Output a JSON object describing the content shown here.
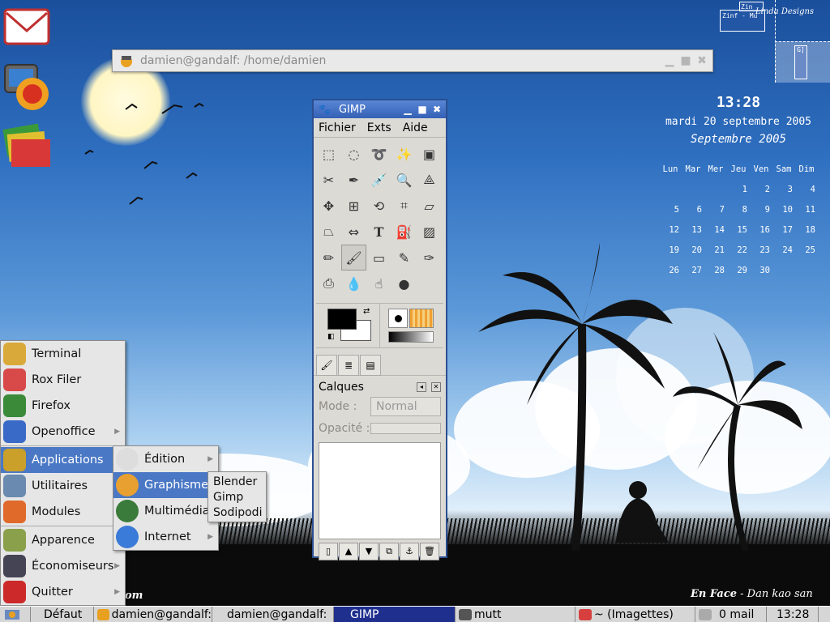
{
  "terminal_window": {
    "title": "damien@gandalf: /home/damien"
  },
  "gimp": {
    "title": "GIMP",
    "menu": [
      "Fichier",
      "Exts",
      "Aide"
    ],
    "tool_icons": [
      "rect-select-icon",
      "ellipse-select-icon",
      "lasso-icon",
      "fuzzy-select-icon",
      "color-select-icon",
      "scissors-icon",
      "paths-icon",
      "color-picker-icon",
      "zoom-icon",
      "measure-icon",
      "move-icon",
      "align-icon",
      "transform-icon",
      "crop-icon",
      "perspective-icon",
      "shear-icon",
      "flip-icon",
      "text-icon",
      "bucket-fill-icon",
      "blend-icon",
      "pencil-icon",
      "paintbrush-icon",
      "eraser-icon",
      "airbrush-icon",
      "ink-icon",
      "clone-icon",
      "blur-icon",
      "smudge-icon",
      "dodge-icon"
    ],
    "active_tool": "paintbrush-icon",
    "layers": {
      "title": "Calques",
      "mode_label": "Mode :",
      "mode_value": "Normal",
      "opacity_label": "Opacité :"
    },
    "layer_buttons": [
      "new-layer-icon",
      "raise-layer-icon",
      "lower-layer-icon",
      "duplicate-layer-icon",
      "anchor-layer-icon",
      "delete-layer-icon"
    ]
  },
  "clock": {
    "time": "13:28",
    "date": "mardi 20 septembre 2005",
    "month": "Septembre 2005"
  },
  "calendar": {
    "days": [
      "Lun",
      "Mar",
      "Mer",
      "Jeu",
      "Ven",
      "Sam",
      "Dim"
    ],
    "weeks": [
      [
        "",
        "",
        "",
        "1",
        "2",
        "3",
        "4"
      ],
      [
        "5",
        "6",
        "7",
        "8",
        "9",
        "10",
        "11"
      ],
      [
        "12",
        "13",
        "14",
        "15",
        "16",
        "17",
        "18"
      ],
      [
        "19",
        "20",
        "21",
        "22",
        "23",
        "24",
        "25"
      ],
      [
        "26",
        "27",
        "28",
        "29",
        "30",
        "",
        ""
      ]
    ]
  },
  "pager": {
    "label1": "Zinf - Mu",
    "label2": "Zin",
    "label3": "G]",
    "brand": "Linda Designs"
  },
  "main_menu": [
    {
      "label": "Terminal",
      "icon": "terminal-shell-icon",
      "color": "#d9a93a"
    },
    {
      "label": "Rox Filer",
      "icon": "rox-filer-icon",
      "color": "#d84a4a"
    },
    {
      "label": "Firefox",
      "icon": "firefox-icon",
      "color": "#3a8a3a"
    },
    {
      "label": "Openoffice",
      "icon": "openoffice-icon",
      "color": "#3a6ac8"
    },
    {
      "label": "Applications",
      "icon": "applications-gear-icon",
      "color": "#caa02a"
    },
    {
      "label": "Utilitaires",
      "icon": "utilities-icon",
      "color": "#6a8ab0"
    },
    {
      "label": "Modules",
      "icon": "modules-cube-icon",
      "color": "#e06a2a"
    },
    {
      "label": "Apparence",
      "icon": "appearance-icon",
      "color": "#8aa04a"
    },
    {
      "label": "Économiseurs",
      "icon": "screensaver-icon",
      "color": "#445"
    },
    {
      "label": "Quitter",
      "icon": "quit-icon",
      "color": "#cc2a2a"
    }
  ],
  "apps_submenu": [
    {
      "label": "Édition",
      "icon": "quill-icon",
      "color": "#ddd"
    },
    {
      "label": "Graphisme",
      "icon": "palette-icon",
      "color": "#e8a030"
    },
    {
      "label": "Multimédia",
      "icon": "multimedia-icon",
      "color": "#3a7a3a"
    },
    {
      "label": "Internet",
      "icon": "globe-icon",
      "color": "#3a7ad8"
    }
  ],
  "graphics_submenu": [
    "Blender",
    "Gimp",
    "Sodipodi"
  ],
  "wallpaper_caption": {
    "title": "En Face",
    "author": " - Dan kao san",
    "left_fragment": "om"
  },
  "taskbar": {
    "start_icon": "start-menu-icon",
    "items": [
      {
        "label": "Défaut",
        "icon": "",
        "active": false
      },
      {
        "label": "damien@gandalf:",
        "icon": "terminal-icon",
        "active": false
      },
      {
        "label": "damien@gandalf:",
        "icon": "",
        "active": false
      },
      {
        "label": "GIMP",
        "icon": "",
        "active": true
      },
      {
        "label": "mutt",
        "icon": "mail-client-icon",
        "active": false
      },
      {
        "label": "~ (Imagettes)",
        "icon": "folder-icon",
        "active": false
      },
      {
        "label": "0 mail",
        "icon": "mail-icon",
        "active": false
      },
      {
        "label": "13:28",
        "icon": "",
        "active": false
      }
    ]
  }
}
